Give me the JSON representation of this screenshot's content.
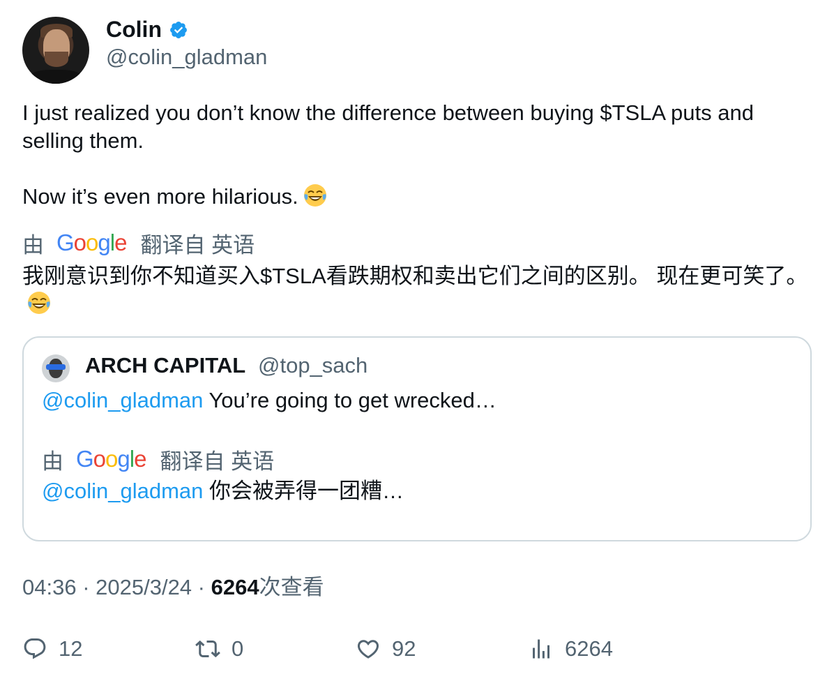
{
  "author": {
    "name": "Colin",
    "handle": "@colin_gladman",
    "verified": true
  },
  "tweet": {
    "paragraph1": "I just realized you don’t know the difference between buying $TSLA puts and selling them.",
    "paragraph2": "Now it’s even more hilarious."
  },
  "translation": {
    "by_label": "由",
    "provider": "Google",
    "from_label": "翻译自 英语",
    "text": "我刚意识到你不知道买入$TSLA看跌期权和卖出它们之间的区别。 现在更可笑了。"
  },
  "quoted": {
    "name": "ARCH CAPITAL",
    "handle": "@top_sach",
    "mention": "@colin_gladman",
    "text": " You’re going to get wrecked…",
    "translation": {
      "by_label": "由",
      "provider": "Google",
      "from_label": "翻译自 英语",
      "mention": "@colin_gladman",
      "text": " 你会被弄得一团糟…"
    }
  },
  "meta": {
    "time": "04:36",
    "date": "2025/3/24",
    "views": "6264",
    "views_label": "次查看"
  },
  "actions": {
    "replies": "12",
    "retweets": "0",
    "likes": "92",
    "views": "6264"
  },
  "colors": {
    "accent": "#1d9bf0",
    "secondary_text": "#536471",
    "border": "#cfd9de"
  },
  "icons": [
    "verified-badge-icon",
    "laughing-tears-emoji",
    "reply-icon",
    "retweet-icon",
    "like-icon",
    "views-icon"
  ]
}
